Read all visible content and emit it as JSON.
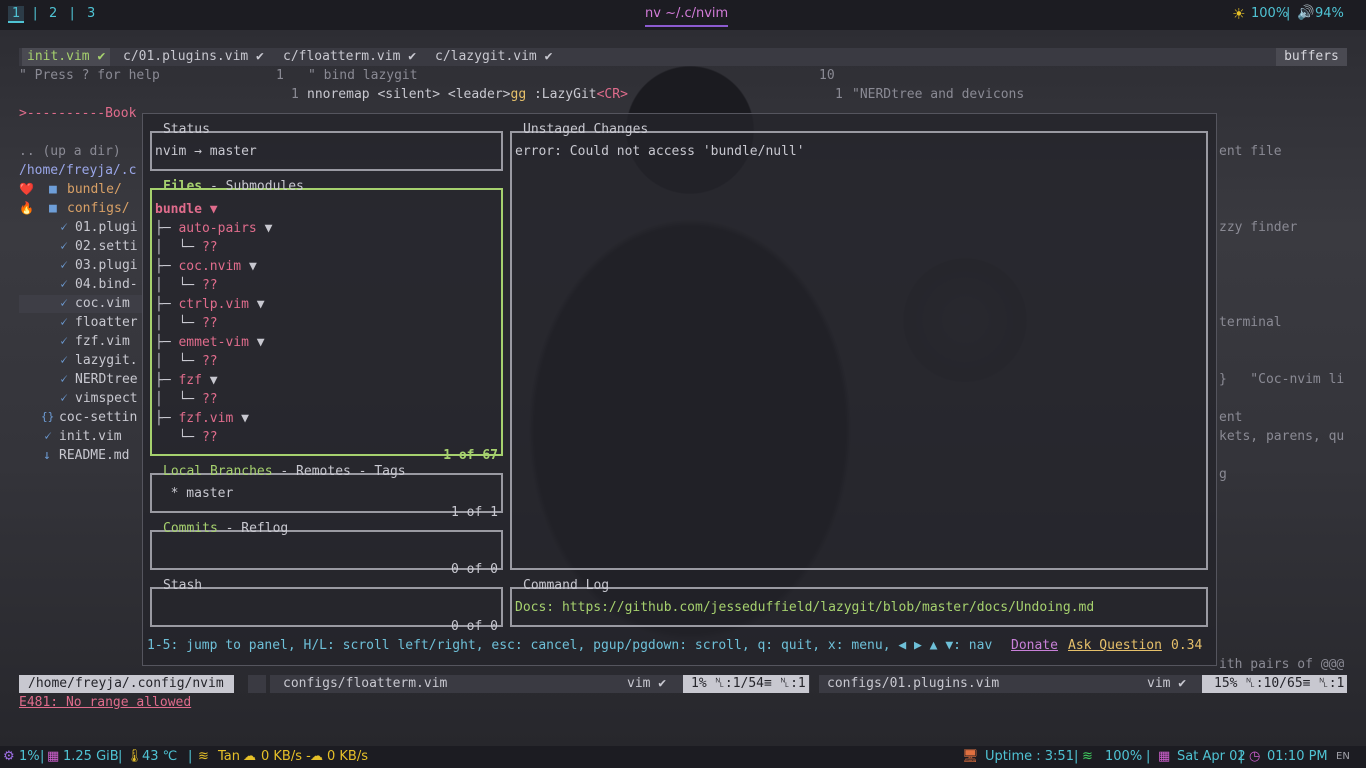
{
  "topbar": {
    "workspaces": [
      "1",
      "2",
      "3"
    ],
    "separator": "|",
    "window_title": "nv ~/.c/nvim",
    "brightness": "100%",
    "volume": "94%"
  },
  "tabline": {
    "tabs": [
      "init.vim ✔",
      "c/01.plugins.vim ✔",
      "c/floatterm.vim ✔",
      "c/lazygit.vim ✔"
    ],
    "buffers_label": "buffers"
  },
  "editor": {
    "help_hint": "\" Press ? for help",
    "line_num_1": "1",
    "line_1_text": "\" bind lazygit",
    "line_num_right": "10",
    "nmap_num": "1",
    "nmap_a": "nnoremap <silent> <leader>",
    "nmap_b": "gg",
    "nmap_c": " :LazyGit",
    "nmap_d": "<CR>",
    "right_line_num": "1",
    "right_line_text": "\"NERDtree and devicons",
    "right_frag_1": "ent file",
    "right_frag_2": "zzy finder",
    "right_frag_3": "terminal",
    "right_frag_4": "}   \"Coc-nvim li",
    "right_frag_5": "ent",
    "right_frag_6": "kets, parens, qu",
    "right_frag_7": "g",
    "right_frag_8": "ith pairs of @@@"
  },
  "tree": {
    "bookmarks": ">----------Book",
    "updir": ".. (up a dir)",
    "path": "/home/freyja/.c",
    "items": [
      {
        "icon": "❤️",
        "label": "bundle/"
      },
      {
        "icon": "🔥",
        "label": "configs/"
      },
      {
        "label": "01.plugi"
      },
      {
        "label": "02.setti"
      },
      {
        "label": "03.plugi"
      },
      {
        "label": "04.bind-"
      },
      {
        "label": "coc.vim"
      },
      {
        "label": "floatter"
      },
      {
        "label": "fzf.vim"
      },
      {
        "label": "lazygit."
      },
      {
        "label": "NERDtree"
      },
      {
        "label": "vimspect"
      },
      {
        "label": "coc-settin"
      },
      {
        "label": "init.vim"
      },
      {
        "label": "README.md"
      }
    ]
  },
  "lazygit": {
    "status": {
      "title": "Status",
      "value": "nvim → master"
    },
    "files": {
      "title": "Files",
      "title_rest": " - Submodules",
      "footer": "1 of 67",
      "root": "bundle ▼",
      "items": [
        "auto-pairs",
        "coc.nvim",
        "ctrlp.vim",
        "emmet-vim",
        "fzf",
        "fzf.vim"
      ],
      "child": "??",
      "arrow": "▼"
    },
    "branches": {
      "title": "Local Branches",
      "title_rest": " - Remotes - Tags",
      "item": "  * master",
      "footer": "1 of 1"
    },
    "commits": {
      "title": "Commits",
      "title_rest": " - Reflog",
      "footer": "0 of 0"
    },
    "stash": {
      "title": "Stash",
      "footer": "0 of 0"
    },
    "unstaged": {
      "title": "Unstaged Changes",
      "message": "error: Could not access 'bundle/null'"
    },
    "command_log": {
      "title": "Command Log",
      "message": "Docs: https://github.com/jesseduffield/lazygit/blob/master/docs/Undoing.md"
    },
    "help": "1-5: jump to panel, H/L: scroll left/right, esc: cancel, pgup/pgdown: scroll, q: quit, x: menu, ◀ ▶ ▲ ▼: nav",
    "donate": "Donate",
    "ask": "Ask Question",
    "version": "0.34"
  },
  "statusline": {
    "path": "/home/freyja/.config/nvim",
    "left_file": "configs/floatterm.vim",
    "left_ft": "vim ✔",
    "left_pos": "1% ␤:1/54≡ ␤:1",
    "right_file": "configs/01.plugins.vim",
    "right_ft": "vim ✔",
    "right_pos": "15% ␤:10/65≡ ␤:1"
  },
  "cmdline": {
    "error": "E481: No range allowed"
  },
  "bottombar": {
    "cpu": "1%",
    "mem": "1.25 GiB",
    "temp": "43 ℃",
    "net_name": "Tan",
    "down": "0 KB/s -",
    "up": "0 KB/s",
    "uptime": "Uptime : 3:51|",
    "wifi": "100%",
    "date": "Sat Apr 02",
    "time": "01:10 PM",
    "lang": "EN"
  },
  "colors": {
    "accent": "#4fc3d4",
    "active_border": "#a6d16e",
    "error": "#e06c8c"
  }
}
